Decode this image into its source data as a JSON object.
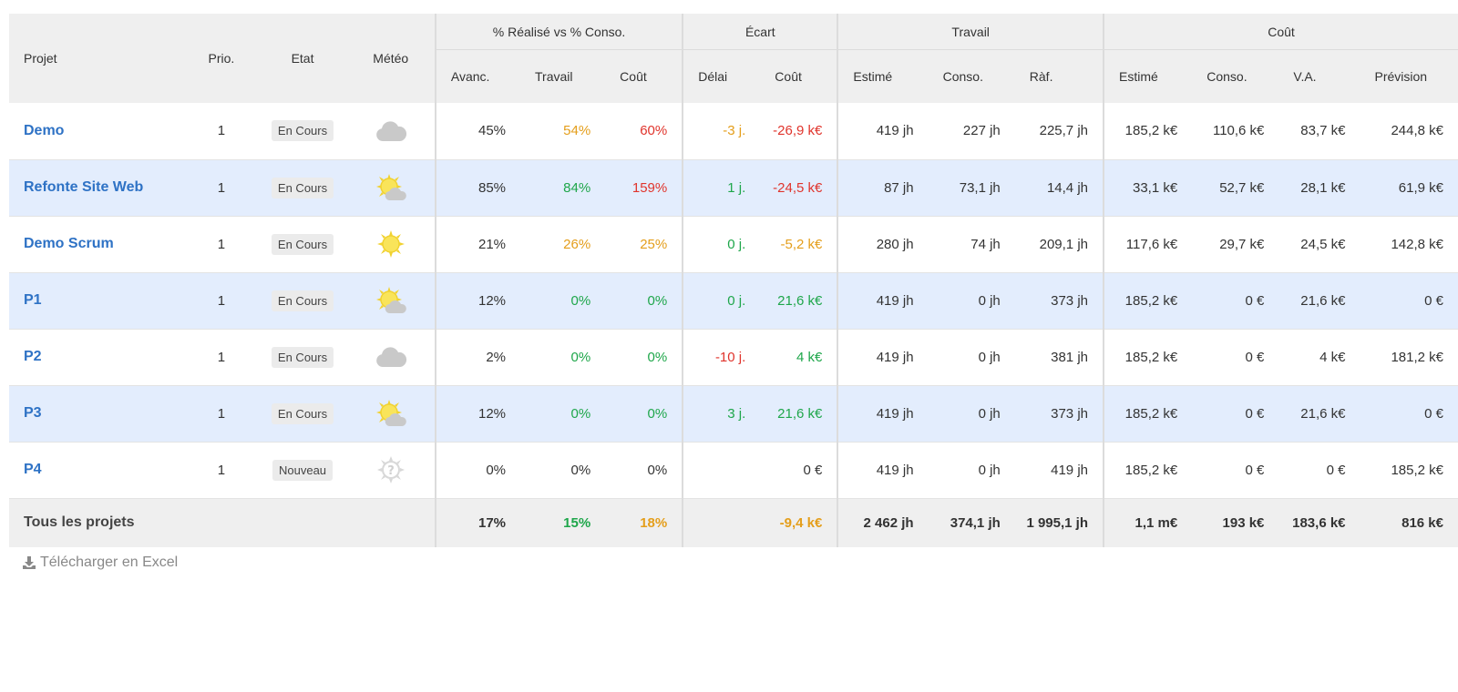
{
  "headers": {
    "projet": "Projet",
    "prio": "Prio.",
    "etat": "Etat",
    "meteo": "Météo",
    "group_realise": "% Réalisé vs % Conso.",
    "group_ecart": "Écart",
    "group_travail": "Travail",
    "group_cout": "Coût",
    "avanc": "Avanc.",
    "travail": "Travail",
    "cout": "Coût",
    "delai": "Délai",
    "ecart_cout": "Coût",
    "trav_estime": "Estimé",
    "trav_conso": "Conso.",
    "trav_raf": "Ràf.",
    "cout_estime": "Estimé",
    "cout_conso": "Conso.",
    "cout_va": "V.A.",
    "cout_prevision": "Prévision"
  },
  "rows": [
    {
      "name": "Demo",
      "prio": "1",
      "etat": "En Cours",
      "meteo": "cloud-icon",
      "avanc": "45%",
      "travail": "54%",
      "travail_color": "orange",
      "cout": "60%",
      "cout_color": "red",
      "delai": "-3 j.",
      "delai_color": "orange",
      "ecart_cout": "-26,9 k€",
      "ecart_cout_color": "red",
      "trav_estime": "419 jh",
      "trav_conso": "227 jh",
      "trav_raf": "225,7 jh",
      "cout_estime": "185,2 k€",
      "cout_conso": "110,6 k€",
      "cout_va": "83,7 k€",
      "cout_prevision": "244,8 k€"
    },
    {
      "name": "Refonte Site Web",
      "prio": "1",
      "etat": "En Cours",
      "meteo": "sun-cloud-icon",
      "avanc": "85%",
      "travail": "84%",
      "travail_color": "green",
      "cout": "159%",
      "cout_color": "red",
      "delai": "1 j.",
      "delai_color": "green",
      "ecart_cout": "-24,5 k€",
      "ecart_cout_color": "red",
      "trav_estime": "87 jh",
      "trav_conso": "73,1 jh",
      "trav_raf": "14,4 jh",
      "cout_estime": "33,1 k€",
      "cout_conso": "52,7 k€",
      "cout_va": "28,1 k€",
      "cout_prevision": "61,9 k€"
    },
    {
      "name": "Demo Scrum",
      "prio": "1",
      "etat": "En Cours",
      "meteo": "sun-icon",
      "avanc": "21%",
      "travail": "26%",
      "travail_color": "orange",
      "cout": "25%",
      "cout_color": "orange",
      "delai": "0 j.",
      "delai_color": "green",
      "ecart_cout": "-5,2 k€",
      "ecart_cout_color": "orange",
      "trav_estime": "280 jh",
      "trav_conso": "74 jh",
      "trav_raf": "209,1 jh",
      "cout_estime": "117,6 k€",
      "cout_conso": "29,7 k€",
      "cout_va": "24,5 k€",
      "cout_prevision": "142,8 k€"
    },
    {
      "name": "P1",
      "prio": "1",
      "etat": "En Cours",
      "meteo": "sun-cloud-icon",
      "avanc": "12%",
      "travail": "0%",
      "travail_color": "green",
      "cout": "0%",
      "cout_color": "green",
      "delai": "0 j.",
      "delai_color": "green",
      "ecart_cout": "21,6 k€",
      "ecart_cout_color": "green",
      "trav_estime": "419 jh",
      "trav_conso": "0 jh",
      "trav_raf": "373 jh",
      "cout_estime": "185,2 k€",
      "cout_conso": "0 €",
      "cout_va": "21,6 k€",
      "cout_prevision": "0 €"
    },
    {
      "name": "P2",
      "prio": "1",
      "etat": "En Cours",
      "meteo": "cloud-icon",
      "avanc": "2%",
      "travail": "0%",
      "travail_color": "green",
      "cout": "0%",
      "cout_color": "green",
      "delai": "-10 j.",
      "delai_color": "red",
      "ecart_cout": "4 k€",
      "ecart_cout_color": "green",
      "trav_estime": "419 jh",
      "trav_conso": "0 jh",
      "trav_raf": "381 jh",
      "cout_estime": "185,2 k€",
      "cout_conso": "0 €",
      "cout_va": "4 k€",
      "cout_prevision": "181,2 k€"
    },
    {
      "name": "P3",
      "prio": "1",
      "etat": "En Cours",
      "meteo": "sun-cloud-icon",
      "avanc": "12%",
      "travail": "0%",
      "travail_color": "green",
      "cout": "0%",
      "cout_color": "green",
      "delai": "3 j.",
      "delai_color": "green",
      "ecart_cout": "21,6 k€",
      "ecart_cout_color": "green",
      "trav_estime": "419 jh",
      "trav_conso": "0 jh",
      "trav_raf": "373 jh",
      "cout_estime": "185,2 k€",
      "cout_conso": "0 €",
      "cout_va": "21,6 k€",
      "cout_prevision": "0 €"
    },
    {
      "name": "P4",
      "prio": "1",
      "etat": "Nouveau",
      "meteo": "unknown-weather-icon",
      "avanc": "0%",
      "travail": "0%",
      "travail_color": "",
      "cout": "0%",
      "cout_color": "",
      "delai": "",
      "delai_color": "",
      "ecart_cout": "0 €",
      "ecart_cout_color": "",
      "trav_estime": "419 jh",
      "trav_conso": "0 jh",
      "trav_raf": "419 jh",
      "cout_estime": "185,2 k€",
      "cout_conso": "0 €",
      "cout_va": "0 €",
      "cout_prevision": "185,2 k€"
    }
  ],
  "total": {
    "label": "Tous les projets",
    "avanc": "17%",
    "travail": "15%",
    "travail_color": "green",
    "cout": "18%",
    "cout_color": "orange",
    "ecart_cout": "-9,4 k€",
    "ecart_cout_color": "orange",
    "trav_estime": "2 462 jh",
    "trav_conso": "374,1 jh",
    "trav_raf": "1 995,1 jh",
    "cout_estime": "1,1 m€",
    "cout_conso": "193 k€",
    "cout_va": "183,6 k€",
    "cout_prevision": "816 k€"
  },
  "download": {
    "label": "Télécharger en Excel",
    "icon": "download-icon"
  },
  "colors": {
    "green": "#1ea64a",
    "orange": "#e49e1b",
    "red": "#e0342c",
    "link": "#2e72c5",
    "row_alt": "#e3edfd",
    "header_bg": "#efefef"
  }
}
